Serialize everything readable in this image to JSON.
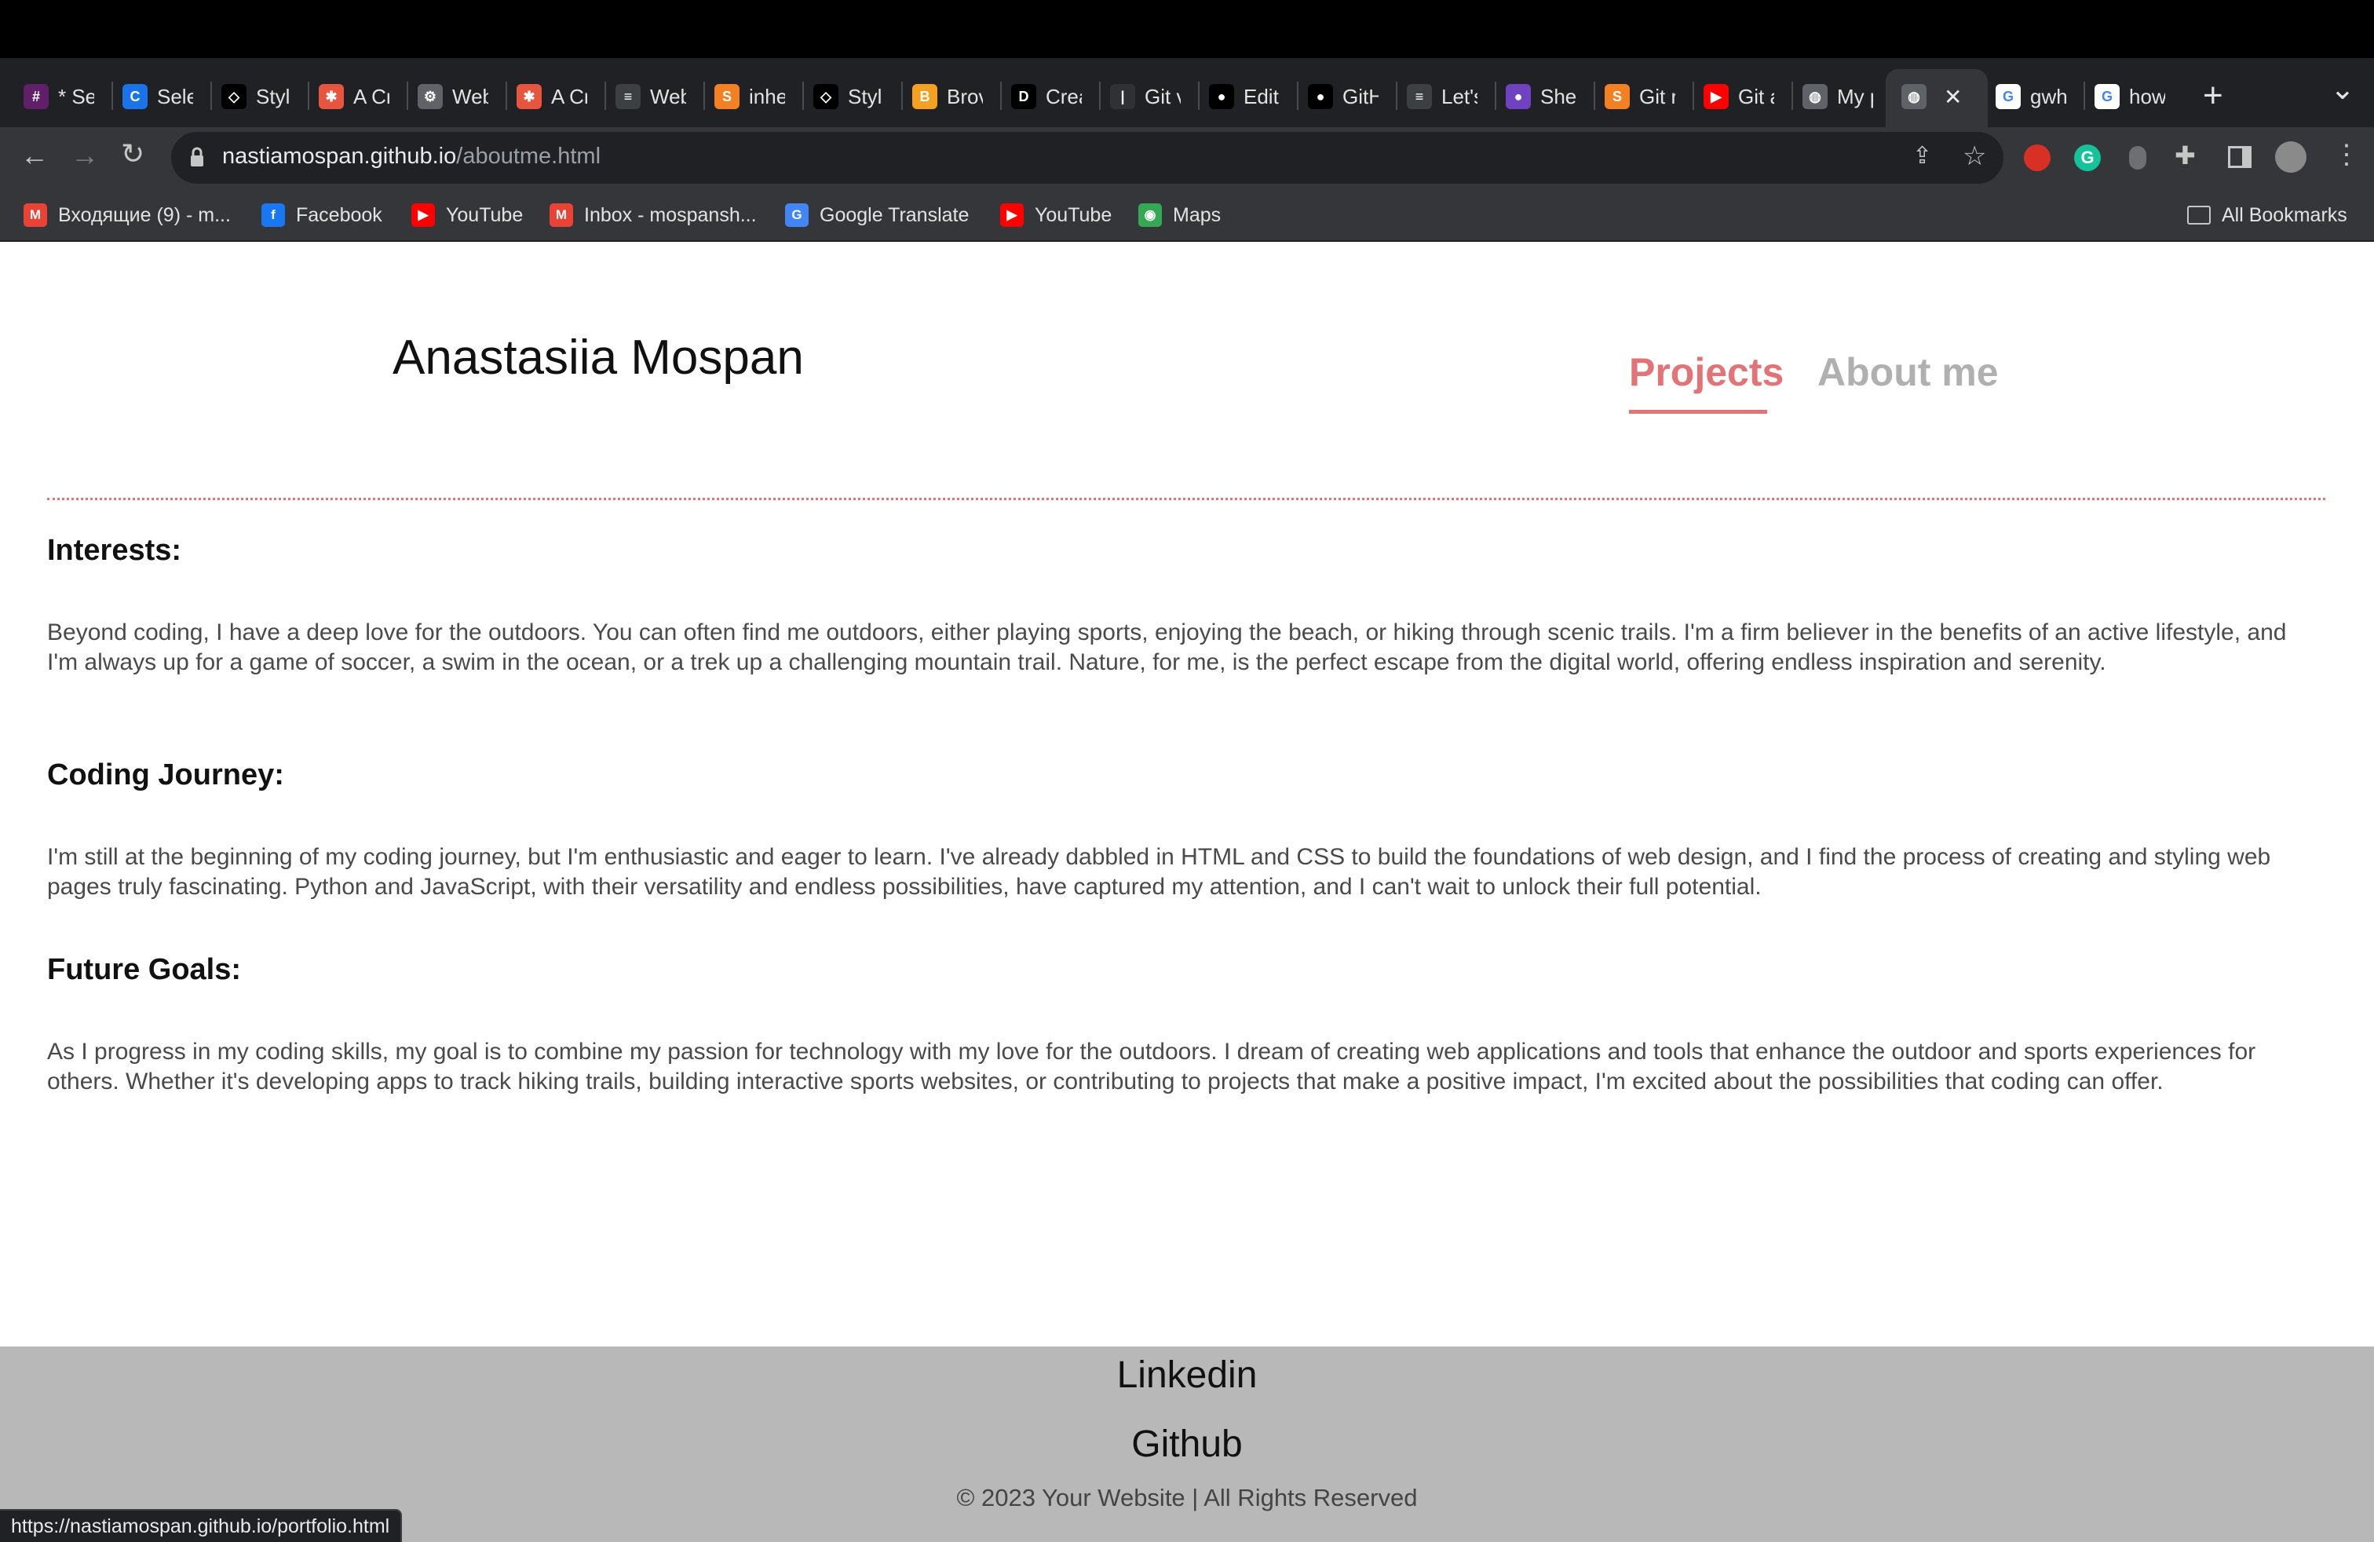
{
  "browser": {
    "tabs": [
      {
        "title": "* Se",
        "icon": "slack-icon",
        "color": "#611f69"
      },
      {
        "title": "Sele",
        "icon": "c-logo-icon",
        "color": "#1a73e8"
      },
      {
        "title": "Styl",
        "icon": "codepen-icon",
        "color": "#000000"
      },
      {
        "title": "A Cr",
        "icon": "asterisk-icon",
        "color": "#e8553e"
      },
      {
        "title": "Web",
        "icon": "gear-icon",
        "color": "#5f6368"
      },
      {
        "title": "A Cr",
        "icon": "asterisk-icon",
        "color": "#e8553e"
      },
      {
        "title": "Web",
        "icon": "bars-icon",
        "color": "#3c4043"
      },
      {
        "title": "inhe",
        "icon": "stackoverflow-icon",
        "color": "#f48024"
      },
      {
        "title": "Styl",
        "icon": "codepen-icon",
        "color": "#000000"
      },
      {
        "title": "Brov",
        "icon": "browserstack-icon",
        "color": "#f4a020"
      },
      {
        "title": "Crea",
        "icon": "dev-icon",
        "color": "#000000"
      },
      {
        "title": "Git v",
        "icon": "git-icon",
        "color": "#2f3134"
      },
      {
        "title": "Edit",
        "icon": "github-icon",
        "color": "#000000"
      },
      {
        "title": "GitH",
        "icon": "github-icon",
        "color": "#000000"
      },
      {
        "title": "Let's",
        "icon": "bars-icon",
        "color": "#3c4043"
      },
      {
        "title": "She",
        "icon": "circle-icon",
        "color": "#6f42c1"
      },
      {
        "title": "Git r",
        "icon": "stackoverflow-icon",
        "color": "#f48024"
      },
      {
        "title": "Git a",
        "icon": "youtube-icon",
        "color": "#ff0000"
      },
      {
        "title": "My p",
        "icon": "globe-icon",
        "color": "#5f6368"
      },
      {
        "title": "",
        "icon": "globe-icon",
        "color": "#5f6368"
      },
      {
        "title": "gwh",
        "icon": "google-icon",
        "color": "#ffffff"
      },
      {
        "title": "how",
        "icon": "google-icon",
        "color": "#ffffff"
      }
    ],
    "new_tab_glyph": "+",
    "close_glyph": "✕",
    "tab_search_glyph": "⌄",
    "address": {
      "host": "nastiamospan.github.io",
      "path": "/aboutme.html"
    },
    "bookmarks": [
      {
        "label": "Входящие (9) - m...",
        "icon": "gmail-icon",
        "color": "#ea4335"
      },
      {
        "label": "Facebook",
        "icon": "facebook-icon",
        "color": "#1877f2"
      },
      {
        "label": "YouTube",
        "icon": "youtube-icon",
        "color": "#ff0000"
      },
      {
        "label": "Inbox - mospansh...",
        "icon": "gmail-icon",
        "color": "#ea4335"
      },
      {
        "label": "Google Translate",
        "icon": "translate-icon",
        "color": "#4285f4"
      },
      {
        "label": "YouTube",
        "icon": "youtube-icon",
        "color": "#ff0000"
      },
      {
        "label": "Maps",
        "icon": "maps-icon",
        "color": "#34a853"
      }
    ],
    "all_bookmarks": "All Bookmarks",
    "status_url": "https://nastiamospan.github.io/portfolio.html"
  },
  "page": {
    "site_name": "Anastasiia Mospan",
    "nav": {
      "projects": "Projects",
      "about": "About me"
    },
    "accent_color": "#e27478",
    "sections": [
      {
        "heading": "Interests:",
        "text": "Beyond coding, I have a deep love for the outdoors. You can often find me outdoors, either playing sports, enjoying the beach, or hiking through scenic trails. I'm a firm believer in the benefits of an active lifestyle, and I'm always up for a game of soccer, a swim in the ocean, or a trek up a challenging mountain trail. Nature, for me, is the perfect escape from the digital world, offering endless inspiration and serenity."
      },
      {
        "heading": "Coding Journey:",
        "text": "I'm still at the beginning of my coding journey, but I'm enthusiastic and eager to learn. I've already dabbled in HTML and CSS to build the foundations of web design, and I find the process of creating and styling web pages truly fascinating. Python and JavaScript, with their versatility and endless possibilities, have captured my attention, and I can't wait to unlock their full potential."
      },
      {
        "heading": "Future Goals:",
        "text": "As I progress in my coding skills, my goal is to combine my passion for technology with my love for the outdoors. I dream of creating web applications and tools that enhance the outdoor and sports experiences for others. Whether it's developing apps to track hiking trails, building interactive sports websites, or contributing to projects that make a positive impact, I'm excited about the possibilities that coding can offer."
      }
    ],
    "footer": {
      "linkedin": "Linkedin",
      "github": "Github",
      "copyright": "© 2023 Your Website | All Rights Reserved"
    }
  }
}
